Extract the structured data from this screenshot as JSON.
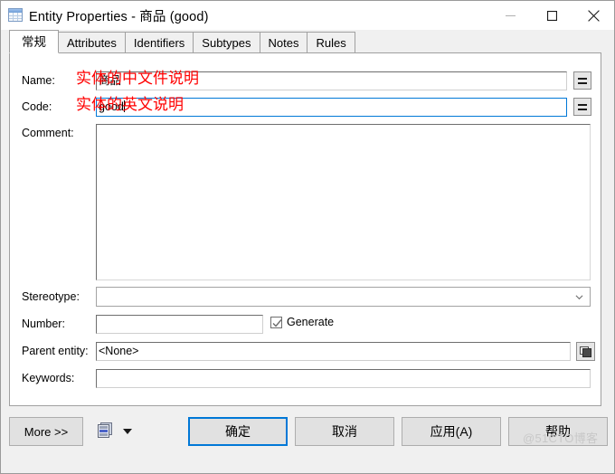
{
  "window": {
    "title": "Entity Properties - 商品 (good)",
    "icon": "table-grid-icon",
    "minimize_label": "—",
    "maximize_label": "□",
    "close_label": "✕"
  },
  "tabs": [
    {
      "label": "常规",
      "selected": true
    },
    {
      "label": "Attributes",
      "selected": false
    },
    {
      "label": "Identifiers",
      "selected": false
    },
    {
      "label": "Subtypes",
      "selected": false
    },
    {
      "label": "Notes",
      "selected": false
    },
    {
      "label": "Rules",
      "selected": false
    }
  ],
  "form": {
    "name": {
      "label": "Name:",
      "value": "商品",
      "equals_button": "="
    },
    "code": {
      "label": "Code:",
      "value": "good",
      "equals_button": "=",
      "focused": true
    },
    "comment": {
      "label": "Comment:",
      "value": ""
    },
    "stereotype": {
      "label": "Stereotype:",
      "value": ""
    },
    "number": {
      "label": "Number:",
      "value": ""
    },
    "generate": {
      "label": "Generate",
      "checked": true
    },
    "parent_entity": {
      "label": "Parent entity:",
      "value": "<None>"
    },
    "keywords": {
      "label": "Keywords:",
      "value": ""
    }
  },
  "annotations": [
    {
      "text": "实体的中文件说明",
      "color": "#ff0000"
    },
    {
      "text": "实体的英文说明",
      "color": "#ff0000"
    }
  ],
  "footer": {
    "more_label": "More >>",
    "report_icon": "report-document-icon",
    "dropdown_icon": "dropdown-arrow-icon",
    "ok_label": "确定",
    "cancel_label": "取消",
    "apply_label": "应用(A)",
    "help_label": "帮助"
  },
  "watermark": {
    "text": "@51CTO博客"
  },
  "colors": {
    "accent": "#0078d7",
    "annotation": "#ff0000",
    "window_bg": "#f0f0f0",
    "panel_bg": "#ffffff",
    "button_bg": "#e1e1e1"
  }
}
